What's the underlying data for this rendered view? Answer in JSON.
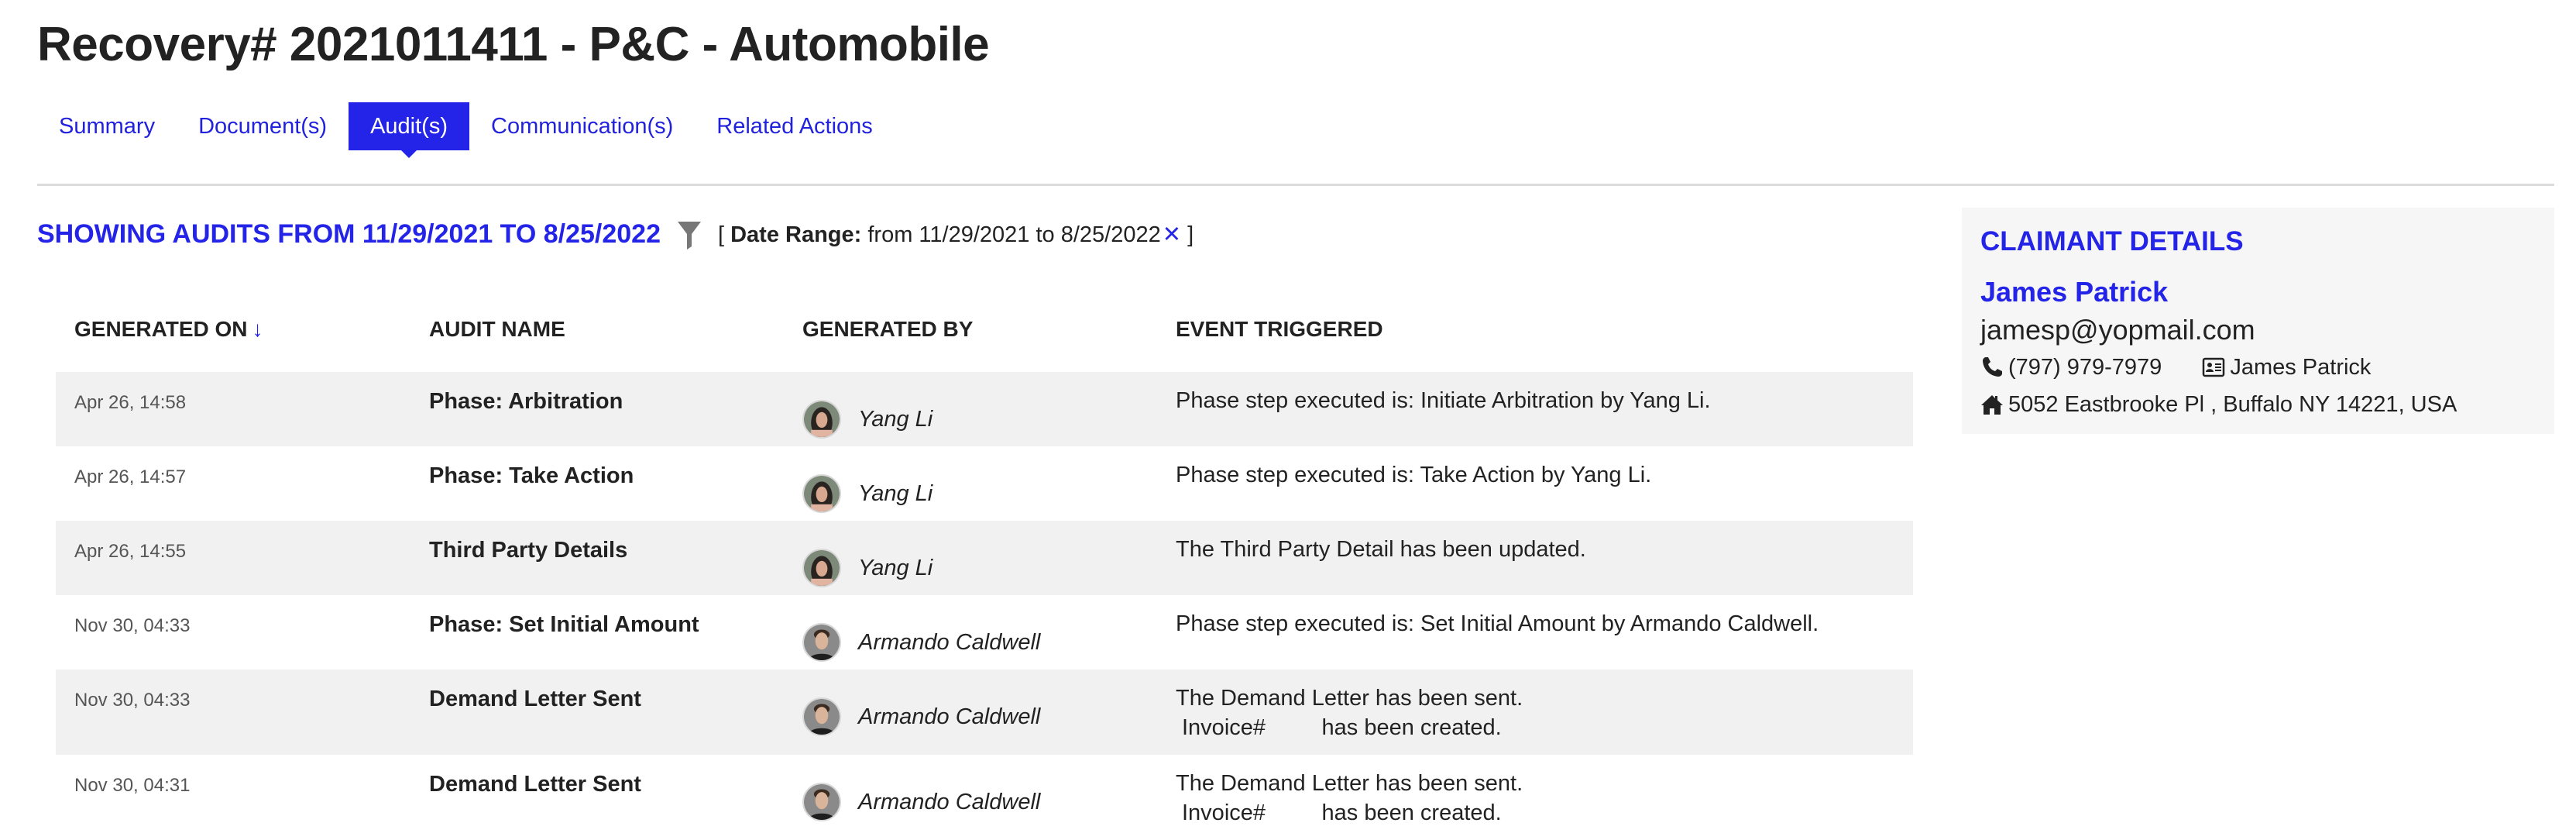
{
  "page": {
    "title": "Recovery# 2021011411 - P&C - Automobile"
  },
  "tabs": [
    {
      "label": "Summary",
      "active": false
    },
    {
      "label": "Document(s)",
      "active": false
    },
    {
      "label": "Audit(s)",
      "active": true
    },
    {
      "label": "Communication(s)",
      "active": false
    },
    {
      "label": "Related Actions",
      "active": false
    }
  ],
  "filter": {
    "heading": "SHOWING AUDITS FROM 11/29/2021 TO 8/25/2022",
    "icon": "filter-icon",
    "open_bracket": "[",
    "range_label": "Date Range:",
    "range_value": "from 11/29/2021 to 8/25/2022",
    "clear_icon": "✕",
    "close_bracket": "]"
  },
  "table": {
    "columns": [
      {
        "label": "GENERATED ON",
        "sort": "descending",
        "sort_icon": "↓"
      },
      {
        "label": "AUDIT NAME"
      },
      {
        "label": "GENERATED BY"
      },
      {
        "label": "EVENT TRIGGERED"
      }
    ],
    "rows": [
      {
        "generated_on": "Apr 26, 14:58",
        "audit_name": "Phase: Arbitration",
        "generated_by": "Yang Li",
        "avatar": "female-avatar",
        "event_line1": "Phase step executed is: Initiate Arbitration by Yang Li.",
        "event_line2": ""
      },
      {
        "generated_on": "Apr 26, 14:57",
        "audit_name": "Phase: Take Action",
        "generated_by": "Yang Li",
        "avatar": "female-avatar",
        "event_line1": "Phase step executed is: Take Action by Yang Li.",
        "event_line2": ""
      },
      {
        "generated_on": "Apr 26, 14:55",
        "audit_name": "Third Party Details",
        "generated_by": "Yang Li",
        "avatar": "female-avatar",
        "event_line1": "The Third Party Detail has been updated.",
        "event_line2": ""
      },
      {
        "generated_on": "Nov 30, 04:33",
        "audit_name": "Phase: Set Initial Amount",
        "generated_by": "Armando Caldwell",
        "avatar": "male-avatar",
        "event_line1": "Phase step executed is: Set Initial Amount by Armando Caldwell.",
        "event_line2": ""
      },
      {
        "generated_on": "Nov 30, 04:33",
        "audit_name": "Demand Letter Sent",
        "generated_by": "Armando Caldwell",
        "avatar": "male-avatar",
        "event_line1": "The Demand Letter has been sent.",
        "event_line2": "Invoice#         has been created."
      },
      {
        "generated_on": "Nov 30, 04:31",
        "audit_name": "Demand Letter Sent",
        "generated_by": "Armando Caldwell",
        "avatar": "male-avatar",
        "event_line1": "The Demand Letter has been sent.",
        "event_line2": "Invoice#         has been created."
      }
    ]
  },
  "claimant": {
    "heading": "CLAIMANT DETAILS",
    "name": "James Patrick",
    "email": "jamesp@yopmail.com",
    "phone": "(797) 979-7979",
    "contact_name": "James Patrick",
    "address": "5052 Eastbrooke Pl , Buffalo NY 14221, USA"
  },
  "colors": {
    "accent": "#2424e8",
    "shaded_row": "#f1f1f1",
    "panel_bg": "#f6f6f6"
  }
}
